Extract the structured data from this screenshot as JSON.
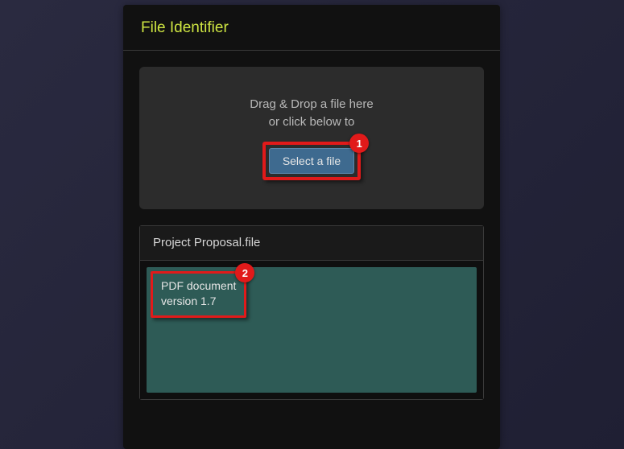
{
  "header": {
    "title": "File Identifier"
  },
  "drop": {
    "line1": "Drag & Drop a file here",
    "line2": "or click below to",
    "button": "Select a file"
  },
  "markers": {
    "select": "1",
    "filetype": "2"
  },
  "result": {
    "filename": "Project Proposal.file",
    "type_line1": "PDF document",
    "type_line2": "version 1.7"
  },
  "colors": {
    "accent": "#cfe642",
    "marker": "#e11a1a",
    "button": "#3e6a8f",
    "resultbox": "#2e5b56"
  }
}
